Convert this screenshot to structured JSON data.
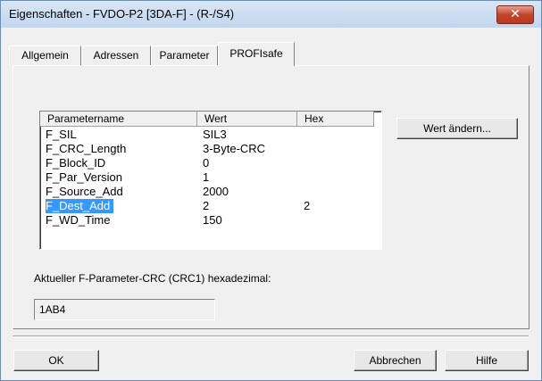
{
  "window": {
    "title": "Eigenschaften - FVDO-P2 [3DA-F] - (R-/S4)",
    "close_glyph": "✕"
  },
  "tabs": [
    {
      "label": "Allgemein",
      "active": false
    },
    {
      "label": "Adressen",
      "active": false
    },
    {
      "label": "Parameter",
      "active": false
    },
    {
      "label": "PROFIsafe",
      "active": true
    }
  ],
  "grid": {
    "columns": [
      "Parametername",
      "Wert",
      "Hex"
    ],
    "rows": [
      {
        "name": "F_SIL",
        "value": "SIL3",
        "hex": ""
      },
      {
        "name": "F_CRC_Length",
        "value": "3-Byte-CRC",
        "hex": ""
      },
      {
        "name": "F_Block_ID",
        "value": "0",
        "hex": ""
      },
      {
        "name": "F_Par_Version",
        "value": "1",
        "hex": ""
      },
      {
        "name": "F_Source_Add",
        "value": "2000",
        "hex": ""
      },
      {
        "name": "F_Dest_Add",
        "value": "2",
        "hex": "2",
        "selected": true
      },
      {
        "name": "F_WD_Time",
        "value": "150",
        "hex": ""
      }
    ]
  },
  "buttons": {
    "change_value": "Wert ändern...",
    "ok": "OK",
    "cancel": "Abbrechen",
    "help": "Hilfe"
  },
  "crc": {
    "label": "Aktueller F-Parameter-CRC (CRC1) hexadezimal:",
    "value": "1AB4"
  },
  "colors": {
    "selection": "#3399ff",
    "close_button": "#c2452b"
  }
}
